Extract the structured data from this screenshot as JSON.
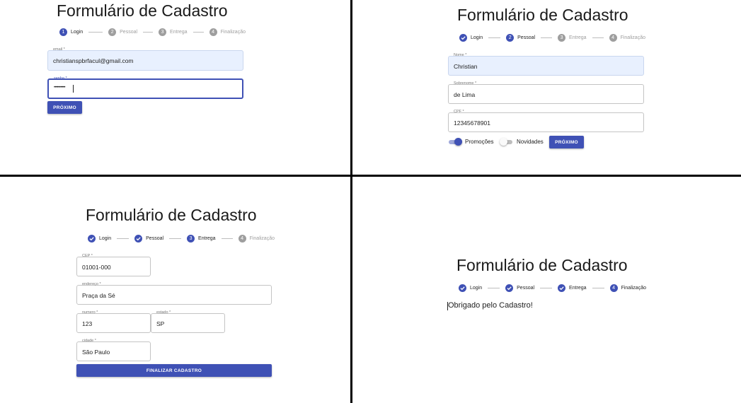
{
  "colors": {
    "primary": "#3f51b5",
    "inactive": "#9e9e9e",
    "autofill": "#e8f0fe"
  },
  "steps": [
    "Login",
    "Pessoal",
    "Entrega",
    "Finalização"
  ],
  "step_numbers": [
    "1",
    "2",
    "3",
    "4"
  ],
  "panel1": {
    "title": "Formulário de Cadastro",
    "email": {
      "label": "email *",
      "value": "christianspbrfacul@gmail.com"
    },
    "senha": {
      "label": "senha *",
      "value": "••••••••••"
    },
    "next_button": "PRÓXIMO"
  },
  "panel2": {
    "title": "Formulário de Cadastro",
    "nome": {
      "label": "Nome *",
      "value": "Christian"
    },
    "sobrenome": {
      "label": "Sobrenome *",
      "value": "de Lima"
    },
    "cpf": {
      "label": "CPF *",
      "value": "12345678901"
    },
    "promocoes": {
      "label": "Promoções",
      "checked": true
    },
    "novidades": {
      "label": "Novidades",
      "checked": false
    },
    "next_button": "PRÓXIMO"
  },
  "panel3": {
    "title": "Formulário de Cadastro",
    "cep": {
      "label": "CEP *",
      "value": "01001-000"
    },
    "endereco": {
      "label": "endereço *",
      "value": "Praça da Sé"
    },
    "numero": {
      "label": "numero *",
      "value": "123"
    },
    "estado": {
      "label": "estado *",
      "value": "SP"
    },
    "cidade": {
      "label": "cidade *",
      "value": "São Paulo"
    },
    "finish_button": "FINALIZAR CADASTRO"
  },
  "panel4": {
    "title": "Formulário de Cadastro",
    "message": "Obrigado pelo Cadastro!"
  }
}
